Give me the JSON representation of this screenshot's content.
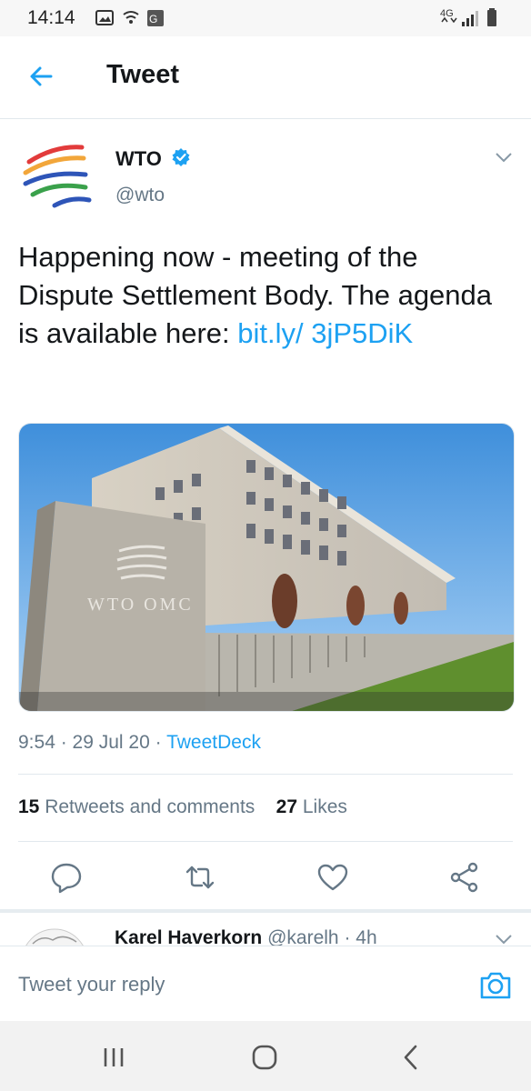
{
  "status_bar": {
    "time": "14:14",
    "network": "4G"
  },
  "header": {
    "title": "Tweet"
  },
  "tweet": {
    "author_name": "WTO",
    "author_handle": "@wto",
    "text_plain": "Happening now - meeting of the Dispute Settlement Body.  The agenda is available here: ",
    "link_text": "bit.ly/ 3jP5DiK",
    "media_sign_text": "WTO OMC",
    "time": "9:54",
    "date": "29 Jul 20",
    "source": "TweetDeck",
    "retweets_count": "15",
    "retweets_label": "Retweets and comments",
    "likes_count": "27",
    "likes_label": "Likes"
  },
  "reply_preview": {
    "name": "Karel Haverkorn",
    "handle": "@karelh",
    "time": "4h"
  },
  "composer": {
    "placeholder": "Tweet your reply"
  },
  "colors": {
    "accent": "#1da1f2",
    "text": "#14171a",
    "secondary": "#657786"
  }
}
